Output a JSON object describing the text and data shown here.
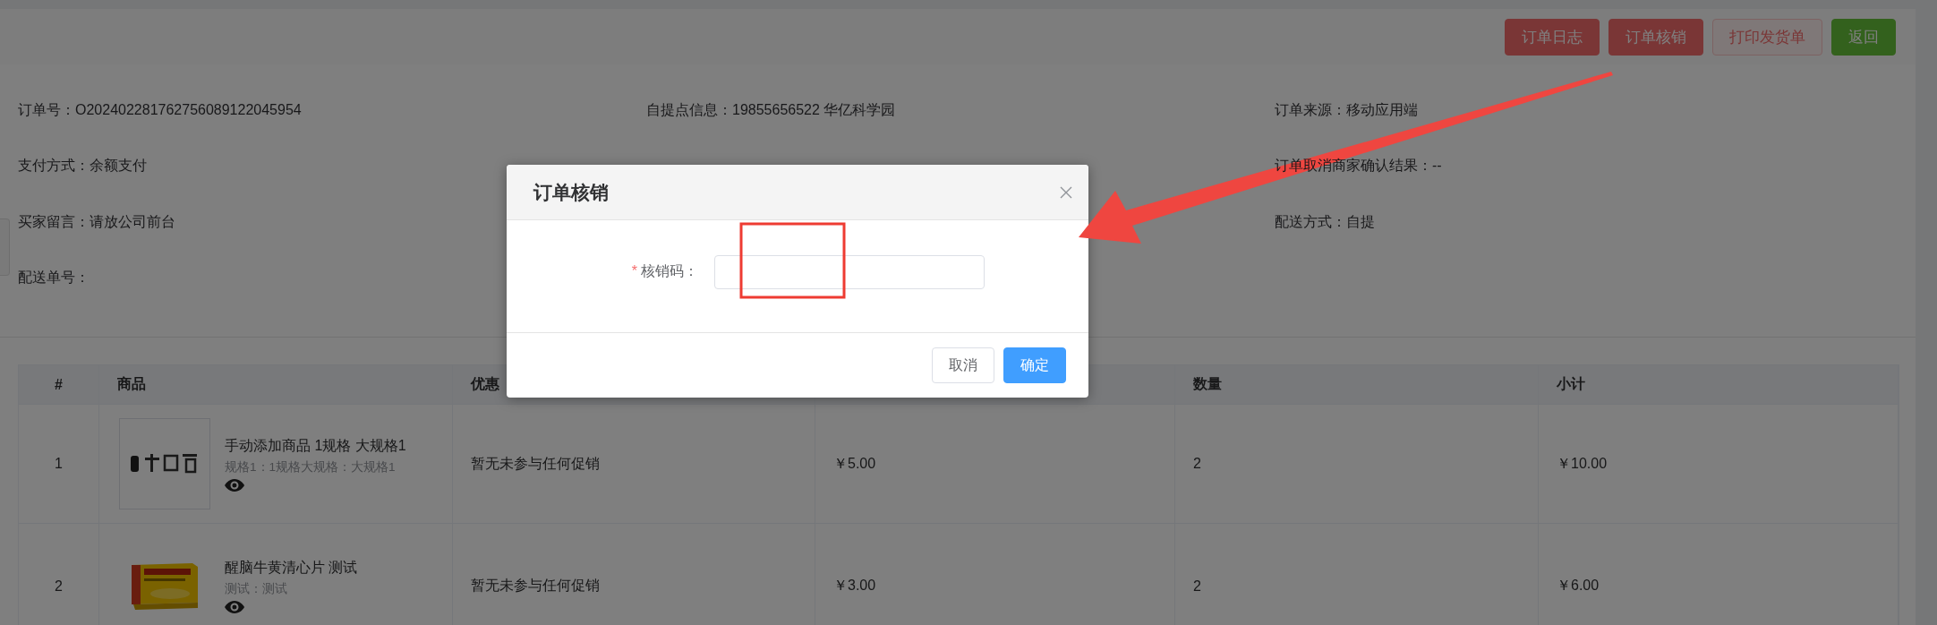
{
  "toolbar": {
    "buttons": [
      {
        "label": "订单日志",
        "kind": "danger"
      },
      {
        "label": "订单核销",
        "kind": "danger"
      },
      {
        "label": "打印发货单",
        "kind": "danger-plain"
      },
      {
        "label": "返回",
        "kind": "success"
      }
    ]
  },
  "order_info": {
    "columns": [
      [
        {
          "label": "订单号：",
          "value": "O202402281762756089122045954"
        },
        {
          "label": "支付方式：",
          "value": "余额支付"
        },
        {
          "label": "买家留言：",
          "value": "请放公司前台"
        },
        {
          "label": "配送单号："
        }
      ],
      [
        {
          "label": "自提点信息：",
          "value": "19855656522 华亿科学园"
        }
      ],
      [
        {
          "label": "订单来源：",
          "value": "移动应用端"
        },
        {
          "label": "订单取消商家确认结果：",
          "value": "--"
        },
        {
          "label": "配送方式：",
          "value": "自提"
        }
      ]
    ]
  },
  "table": {
    "columns": [
      {
        "label": "#"
      },
      {
        "label": "商品"
      },
      {
        "label": "优惠"
      },
      {},
      {
        "label": "数量"
      },
      {
        "label": "小计"
      }
    ],
    "rows": [
      {
        "index": "1",
        "product": {
          "name": "手动添加商品 1规格 大规格1",
          "spec": "规格1：1规格大规格：大规格1"
        },
        "promotion": "暂无未参与任何促销",
        "price": "￥5.00",
        "quantity": "2",
        "subtotal": "￥10.00"
      },
      {
        "index": "2",
        "product": {
          "name": "醒脑牛黄清心片 测试",
          "spec": "测试：测试"
        },
        "promotion": "暂无未参与任何促销",
        "price": "￥3.00",
        "quantity": "2",
        "subtotal": "￥6.00"
      }
    ]
  },
  "verify_dialog": {
    "title": "订单核销",
    "field": {
      "required_mark": "*",
      "label": "核销码："
    },
    "buttons": [
      {
        "label": "取消",
        "kind": "default"
      },
      {
        "label": "确定",
        "kind": "primary"
      }
    ]
  }
}
